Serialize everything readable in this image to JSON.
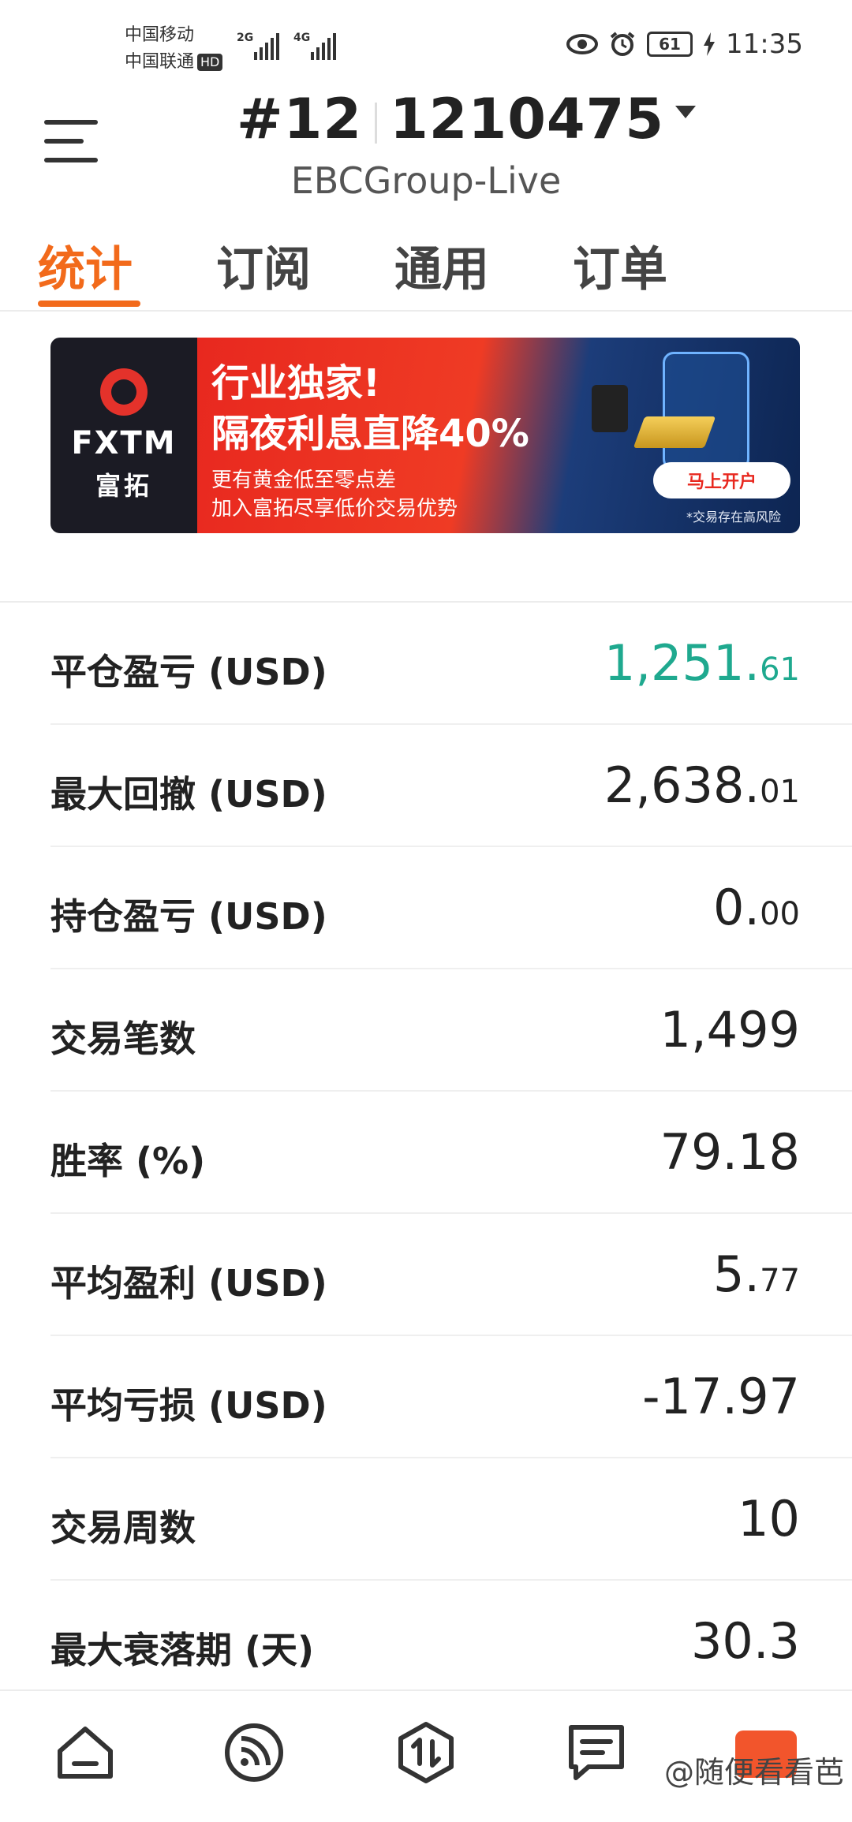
{
  "status_bar": {
    "carrier1": "中国移动",
    "carrier2": "中国联通",
    "hd": "HD",
    "sig1_tag": "2G",
    "sig2_tag": "4G",
    "battery": "61",
    "time": "11:35"
  },
  "header": {
    "account_prefix": "#12",
    "account_number": "1210475",
    "server": "EBCGroup-Live"
  },
  "tabs": [
    {
      "label": "统计"
    },
    {
      "label": "订阅"
    },
    {
      "label": "通用"
    },
    {
      "label": "订单"
    }
  ],
  "banner": {
    "logo_text": "FXTM",
    "logo_cn": "富拓",
    "headline1": "行业独家!",
    "headline2": "隔夜利息直降40%",
    "sub1": "更有黄金低至零点差",
    "sub2": "加入富拓尽享低价交易优势",
    "button": "马上开户",
    "risk": "*交易存在高风险"
  },
  "stats": [
    {
      "label": "平仓盈亏 (USD)",
      "int": "1,251.",
      "dec": "61",
      "color": "#1fa98f"
    },
    {
      "label": "最大回撤 (USD)",
      "int": "2,638.",
      "dec": "01"
    },
    {
      "label": "持仓盈亏 (USD)",
      "int": "0.",
      "dec": "00"
    },
    {
      "label": "交易笔数",
      "int": "1,499",
      "dec": ""
    },
    {
      "label": "胜率 (%)",
      "int": "79.18",
      "dec": ""
    },
    {
      "label": "平均盈利 (USD)",
      "int": "5.",
      "dec": "77"
    },
    {
      "label": "平均亏损 (USD)",
      "int": "-17.97",
      "dec": ""
    },
    {
      "label": "交易周数",
      "int": "10",
      "dec": ""
    },
    {
      "label": "最大衰落期 (天)",
      "int": "30.3",
      "dec": ""
    }
  ],
  "watermark": "@随便看看芭"
}
